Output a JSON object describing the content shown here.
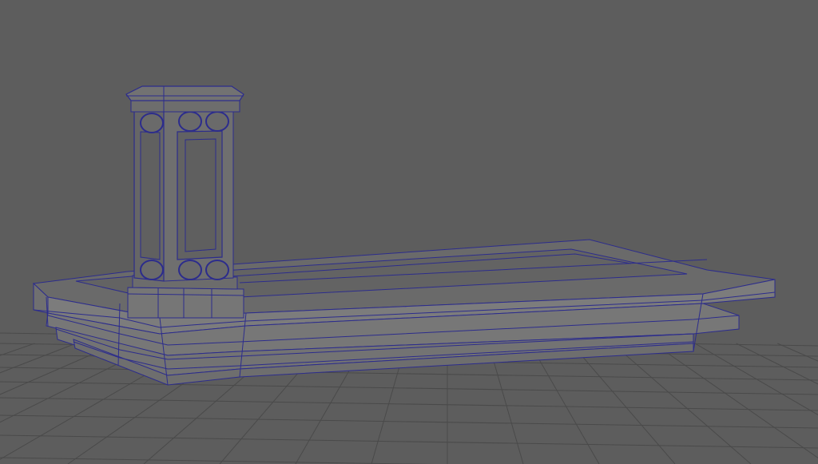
{
  "scene": {
    "background_color": "#5d5d5d",
    "grid_color": "#4a4a4a",
    "wire_color": "#2c2c8c",
    "model_face_color": "#757575",
    "model_face_light": "#7c7c7c",
    "model_face_dark": "#5f5f5f",
    "model_top_color": "#6a6a6a"
  }
}
